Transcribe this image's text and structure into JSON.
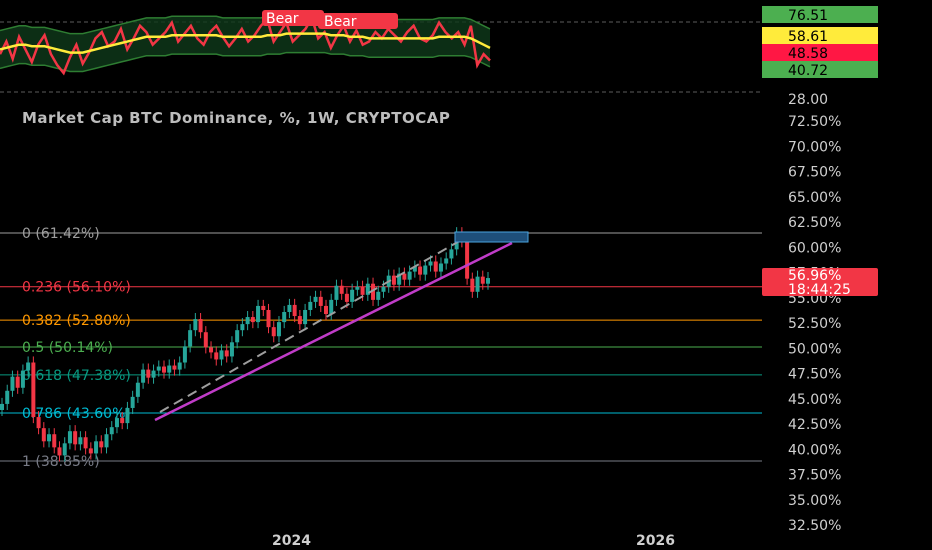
{
  "chart_data": [
    {
      "type": "line",
      "panel": "oscillator",
      "y_labels": [
        "76.51",
        "58.61",
        "48.58",
        "40.72",
        "28.00"
      ],
      "y_label_colors": [
        "#4caf50",
        "#ffeb3b",
        "#ff1744",
        "#4caf50",
        ""
      ],
      "signal_labels": [
        "Bear",
        "Bear"
      ],
      "series": [
        {
          "values": [
            52,
            60,
            49,
            63,
            55,
            47,
            58,
            64,
            52,
            45,
            40,
            50,
            58,
            46,
            53,
            62,
            66,
            57,
            60,
            68,
            55,
            62,
            70,
            66,
            58,
            62,
            66,
            72,
            60,
            65,
            70,
            62,
            58,
            66,
            70,
            63,
            57,
            62,
            68,
            60,
            64,
            70,
            74,
            60,
            66,
            72,
            60,
            64,
            68,
            75,
            62,
            66,
            56,
            64,
            70,
            60,
            67,
            58,
            60,
            66,
            62,
            68,
            64,
            60,
            66,
            70,
            62,
            60,
            64,
            72,
            66,
            62,
            66,
            58,
            70,
            45,
            52,
            48
          ]
        },
        {
          "values": [
            55,
            56,
            57,
            58,
            58,
            57,
            57,
            57,
            56,
            55,
            54,
            53,
            53,
            53,
            54,
            55,
            56,
            57,
            58,
            59,
            60,
            61,
            62,
            63,
            63,
            63,
            63,
            64,
            64,
            64,
            64,
            64,
            64,
            64,
            64,
            63,
            63,
            63,
            63,
            63,
            63,
            63,
            64,
            64,
            64,
            65,
            65,
            65,
            65,
            65,
            65,
            65,
            64,
            64,
            64,
            63,
            63,
            63,
            62,
            62,
            62,
            62,
            62,
            62,
            62,
            62,
            62,
            62,
            62,
            63,
            63,
            63,
            63,
            63,
            62,
            60,
            58,
            56
          ]
        }
      ]
    },
    {
      "type": "candlestick",
      "title": "Market Cap BTC Dominance, %, 1W, CRYPTOCAP",
      "y_ticks": [
        "72.50%",
        "70.00%",
        "67.50%",
        "65.00%",
        "62.50%",
        "60.00%",
        "57.50%",
        "55.00%",
        "52.50%",
        "50.00%",
        "47.50%",
        "45.00%",
        "42.50%",
        "40.00%",
        "37.50%",
        "35.00%",
        "32.50%"
      ],
      "x_ticks": [
        "2024",
        "2026"
      ],
      "current_value": "56.96%",
      "countdown": "18:44:25",
      "fib_levels": [
        {
          "label": "0 (61.42%)",
          "value": 61.42,
          "color": "#9e9e9e"
        },
        {
          "label": "0.236 (56.10%)",
          "value": 56.1,
          "color": "#f23645"
        },
        {
          "label": "0.382 (52.80%)",
          "value": 52.8,
          "color": "#ff9800"
        },
        {
          "label": "0.5 (50.14%)",
          "value": 50.14,
          "color": "#4caf50"
        },
        {
          "label": "0.618 (47.38%)",
          "value": 47.38,
          "color": "#089981"
        },
        {
          "label": "0.786 (43.60%)",
          "value": 43.6,
          "color": "#00bcd4"
        },
        {
          "label": "1 (38.85%)",
          "value": 38.85,
          "color": "#787b86"
        }
      ],
      "close_values": [
        44.5,
        45.8,
        47.2,
        46.1,
        47.8,
        48.6,
        43.2,
        42.1,
        40.8,
        41.5,
        40.2,
        39.4,
        40.6,
        41.8,
        40.5,
        41.2,
        40.1,
        39.6,
        40.8,
        40.2,
        41.5,
        42.2,
        43.1,
        42.6,
        44.1,
        45.2,
        46.6,
        47.9,
        47.1,
        47.8,
        48.2,
        47.6,
        48.3,
        47.9,
        48.6,
        50.2,
        51.8,
        52.9,
        51.6,
        50.1,
        49.6,
        48.9,
        49.8,
        49.2,
        50.6,
        51.8,
        52.4,
        53.1,
        52.6,
        54.2,
        53.8,
        52.1,
        51.2,
        52.6,
        53.6,
        54.3,
        53.2,
        52.4,
        53.8,
        54.6,
        55.1,
        54.2,
        53.4,
        54.8,
        56.2,
        55.4,
        54.6,
        55.8,
        56.1,
        55.3,
        56.4,
        54.8,
        55.6,
        56.1,
        57.2,
        56.3,
        57.4,
        56.8,
        57.6,
        58.1,
        57.3,
        58.2,
        58.6,
        57.6,
        58.4,
        58.9,
        59.8,
        61.4,
        60.6,
        56.9,
        55.6,
        57.1,
        56.4,
        56.96
      ]
    }
  ]
}
